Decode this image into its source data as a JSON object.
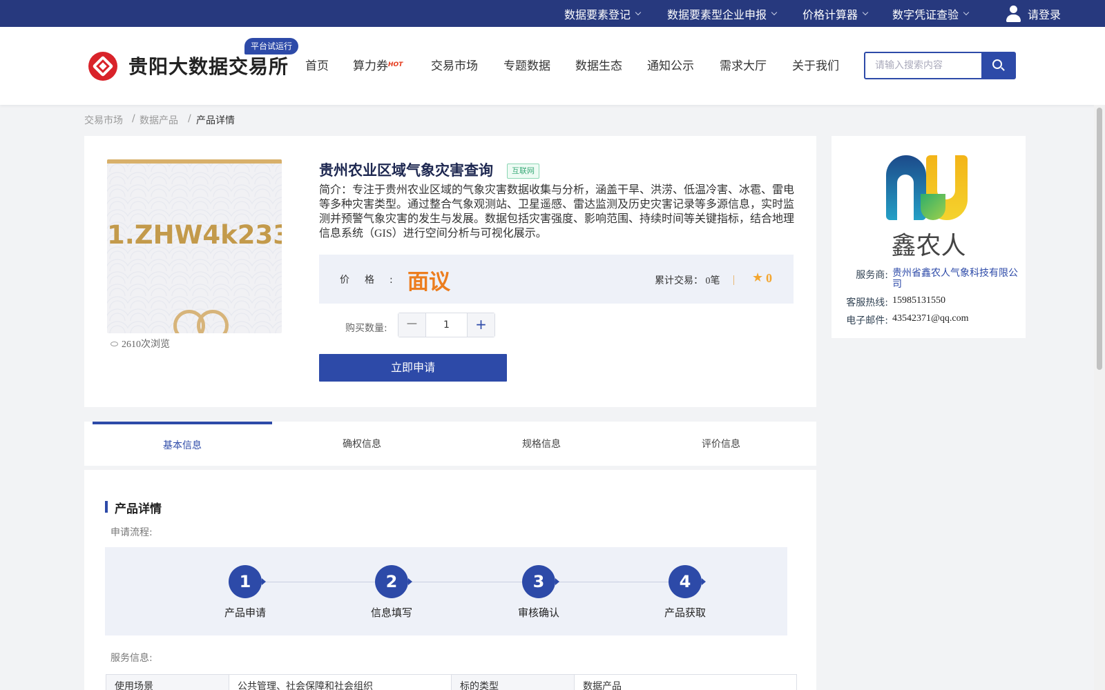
{
  "topbar": {
    "items": [
      "数据要素登记",
      "数据要素型企业申报",
      "价格计算器",
      "数字凭证查验"
    ],
    "login": "请登录"
  },
  "header": {
    "logo_text": "贵阳大数据交易所",
    "trial_badge": "平台试运行",
    "nav": [
      "首页",
      "算力券",
      "交易市场",
      "专题数据",
      "数据生态",
      "通知公示",
      "需求大厅",
      "关于我们"
    ],
    "hot_badge": "HOT",
    "search_placeholder": "请输入搜索内容"
  },
  "breadcrumb": [
    "交易市场",
    "数据产品",
    "产品详情"
  ],
  "breadcrumb_separator": "/",
  "product": {
    "thumb_code": "1.ZHW4k233",
    "views": "2610次浏览",
    "title": "贵州农业区域气象灾害查询",
    "tag": "互联网",
    "intro": "简介：专注于贵州农业区域的气象灾害数据收集与分析，涵盖干旱、洪涝、低温冷害、冰雹、雷电等多种灾害类型。通过整合气象观测站、卫星遥感、雷达监测及历史灾害记录等多源信息，实时监测并预警气象灾害的发生与发展。数据包括灾害强度、影响范围、持续时间等关键指标，结合地理信息系统（GIS）进行空间分析与可视化展示。",
    "price_label": "价格:",
    "price_value": "面议",
    "trades": "累计交易：  0笔",
    "score": "0",
    "qty_label": "购买数量:",
    "qty_value": "1",
    "apply_label": "立即申请"
  },
  "provider": {
    "name": "鑫农人",
    "service_label": "服务商:",
    "service_value": "贵州省鑫农人气象科技有限公司",
    "hotline_label": "客服热线:",
    "hotline_value": "15985131550",
    "email_label": "电子邮件:",
    "email_value": "43542371@qq.com"
  },
  "tabs": [
    "基本信息",
    "确权信息",
    "规格信息",
    "评价信息"
  ],
  "detail": {
    "section_title": "产品详情",
    "flow_label": "申请流程:",
    "steps": [
      {
        "num": "1",
        "label": "产品申请"
      },
      {
        "num": "2",
        "label": "信息填写"
      },
      {
        "num": "3",
        "label": "审核确认"
      },
      {
        "num": "4",
        "label": "产品获取"
      }
    ],
    "service_label": "服务信息:",
    "table": [
      [
        "使用场景",
        "公共管理、社会保障和社会组织",
        "标的类型",
        "数据产品"
      ]
    ]
  },
  "colors": {
    "primary": "#2d4aa8",
    "topbar": "#27397e",
    "price": "#ec7d1e",
    "brand_red": "#d9232a"
  }
}
